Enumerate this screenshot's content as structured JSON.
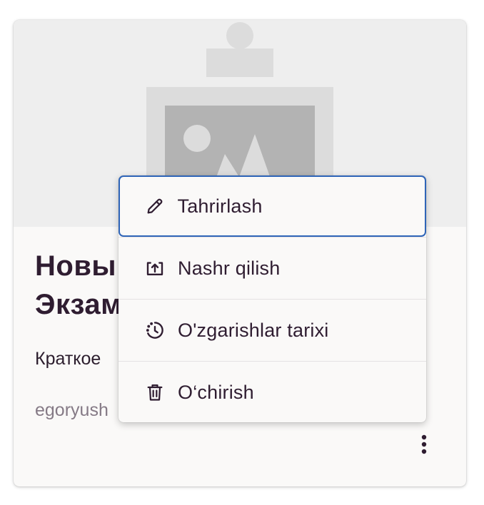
{
  "card": {
    "image_icon": "image-placeholder-icon",
    "title": "Новы\nЭкзам",
    "description": "Краткое",
    "author": "egoryush",
    "more_icon": "more-vertical-icon"
  },
  "menu": {
    "items": [
      {
        "label": "Tahrirlash",
        "icon": "pencil-icon"
      },
      {
        "label": "Nashr qilish",
        "icon": "publish-icon"
      },
      {
        "label": "O'zgarishlar tarixi",
        "icon": "history-icon"
      },
      {
        "label": "O‘chirish",
        "icon": "trash-icon"
      }
    ]
  },
  "colors": {
    "focus_ring": "#2f65b8",
    "text": "#2f1d31",
    "muted_text": "#857a86",
    "card_background": "#faf9f8",
    "image_background": "#eeeeee"
  }
}
